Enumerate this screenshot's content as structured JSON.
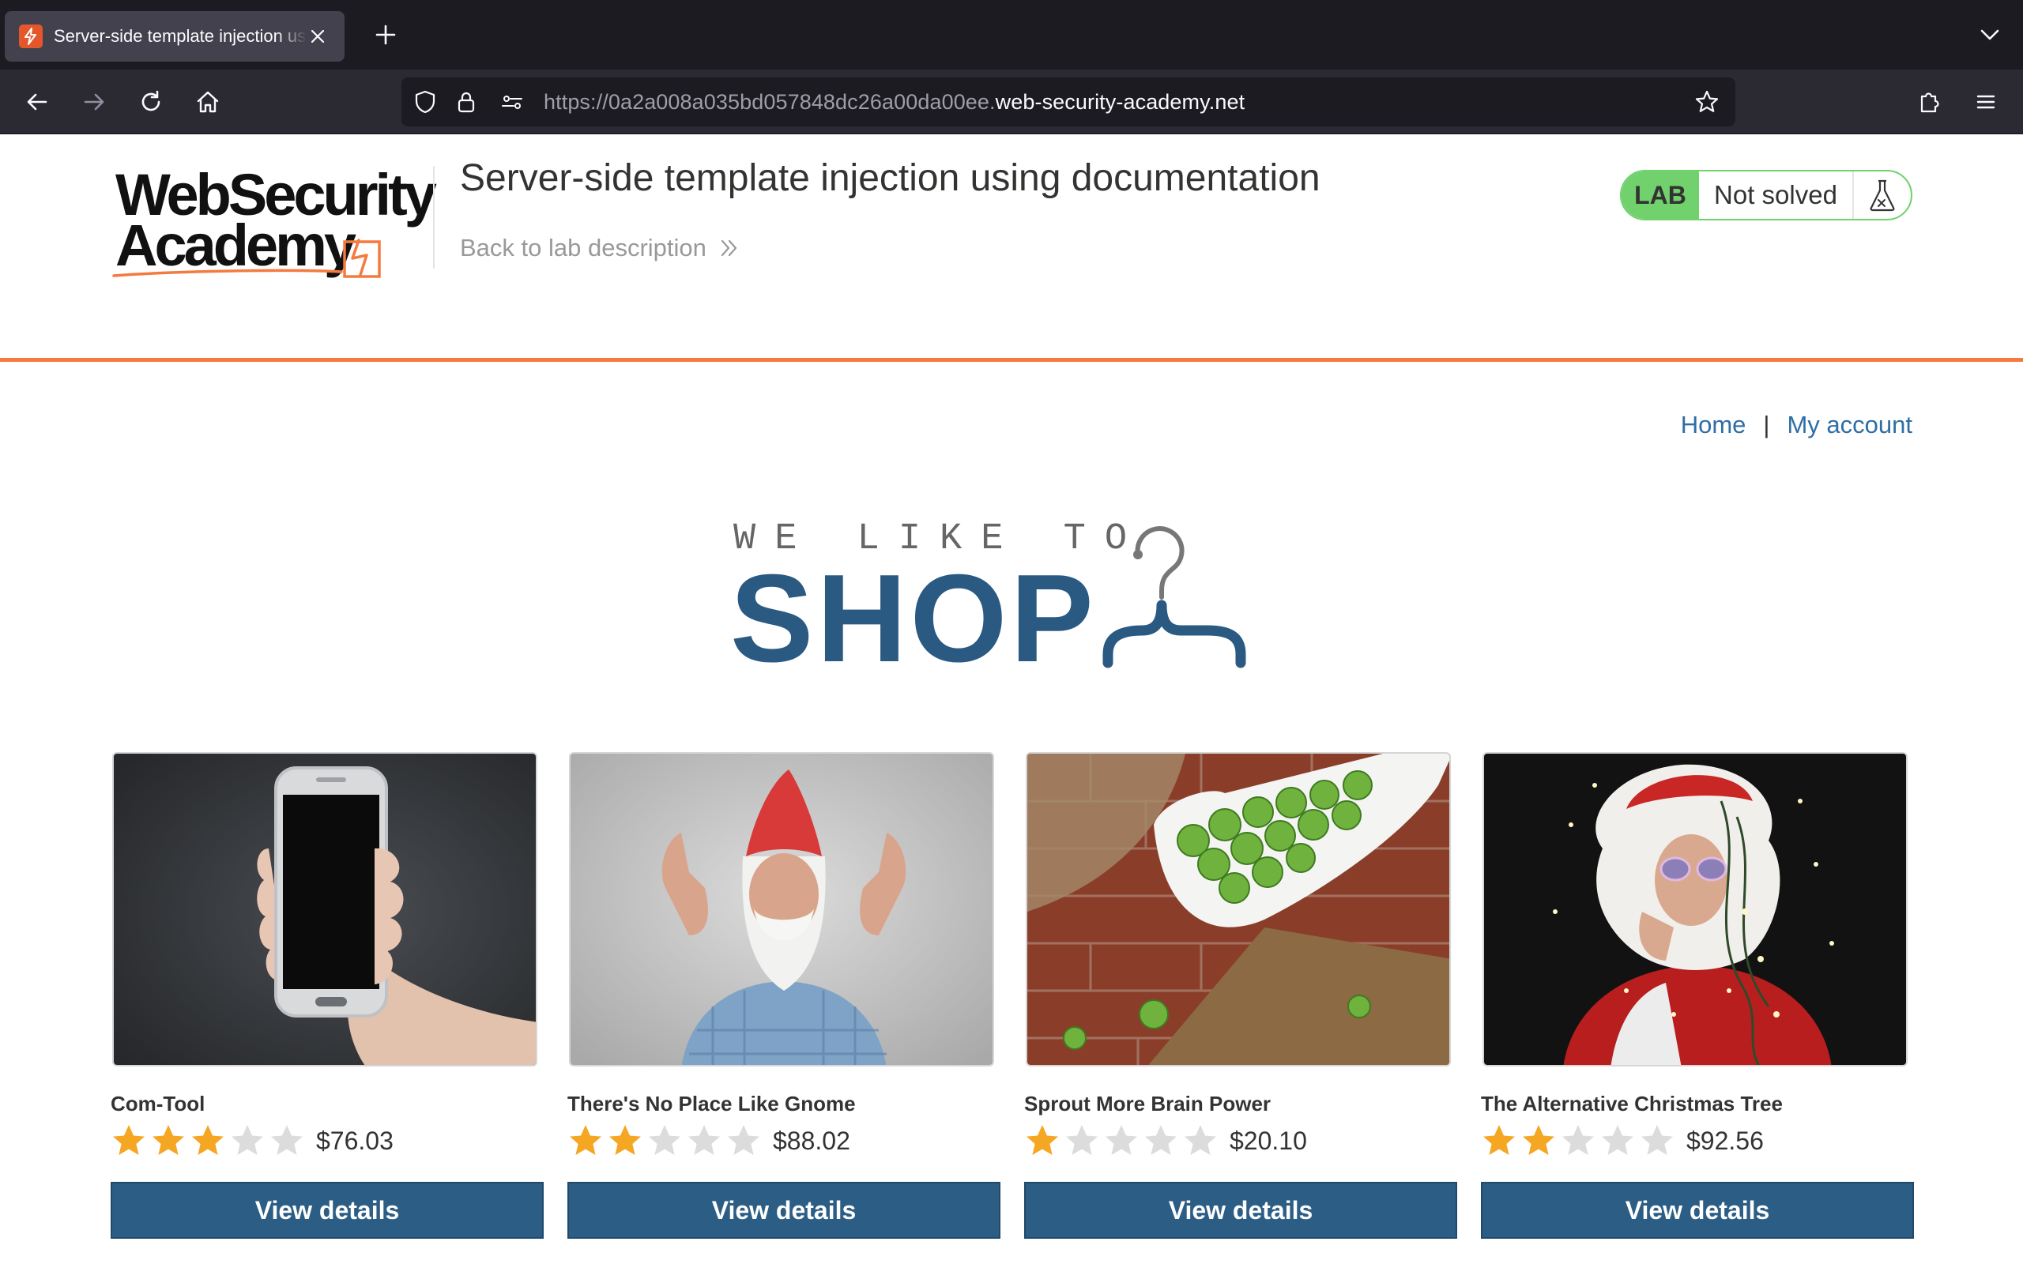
{
  "browser": {
    "tab_title": "Server-side template injection using documentation",
    "url_prefix": "https://0a2a008a035bd057848dc26a00da00ee.",
    "url_domain": "web-security-academy.net"
  },
  "lab": {
    "logo_line1": "WebSecurity",
    "logo_line2": "Academy",
    "title": "Server-side template injection using documentation",
    "back_link": "Back to lab description",
    "badge": "LAB",
    "status": "Not solved"
  },
  "nav": {
    "home": "Home",
    "separator": "|",
    "account": "My account"
  },
  "banner": {
    "line1": "WE LIKE TO",
    "line2": "SHOP"
  },
  "colors": {
    "accent_orange": "#f47a3f",
    "lab_green": "#70d16d",
    "button_blue": "#2c5e85",
    "link_blue": "#2f6ea5",
    "star_gold": "#f5a623",
    "star_empty": "#dcdcdc"
  },
  "products": [
    {
      "name": "Com-Tool",
      "rating": 3,
      "max_rating": 5,
      "price": "$76.03",
      "button": "View details",
      "image": "hand-holding-phone"
    },
    {
      "name": "There's No Place Like Gnome",
      "rating": 2,
      "max_rating": 5,
      "price": "$88.02",
      "button": "View details",
      "image": "man-dressed-as-gnome"
    },
    {
      "name": "Sprout More Brain Power",
      "rating": 1,
      "max_rating": 5,
      "price": "$20.10",
      "button": "View details",
      "image": "bowl-of-sprouts"
    },
    {
      "name": "The Alternative Christmas Tree",
      "rating": 2,
      "max_rating": 5,
      "price": "$92.56",
      "button": "View details",
      "image": "man-wrapped-in-lights"
    }
  ]
}
